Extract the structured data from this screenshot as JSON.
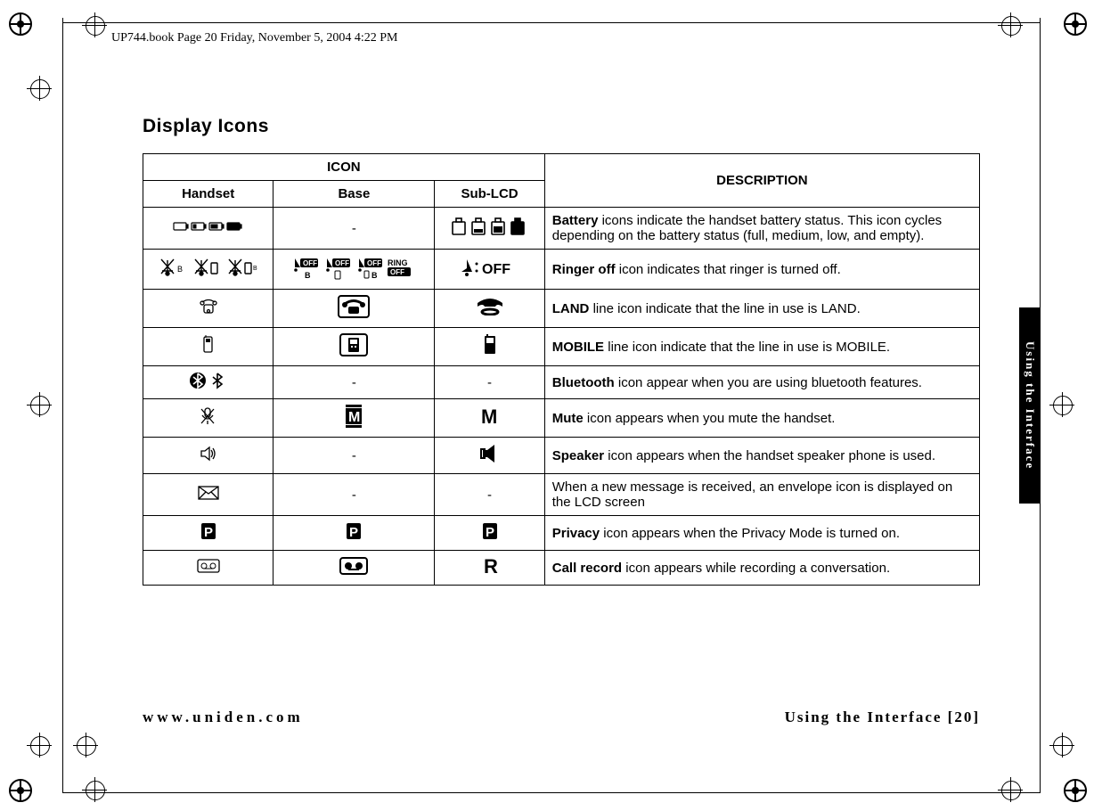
{
  "header_note": "UP744.book  Page 20  Friday, November 5, 2004  4:22 PM",
  "page_title": "Display Icons",
  "columns": {
    "icon": "ICON",
    "handset": "Handset",
    "base": "Base",
    "sublcd": "Sub-LCD",
    "description": "DESCRIPTION"
  },
  "rows": [
    {
      "lead": "Battery",
      "rest": " icons indicate the handset battery status. This icon cycles depending on the battery status (full, medium, low, and empty).",
      "base": "-",
      "sub": null,
      "handset": null
    },
    {
      "lead": "Ringer off",
      "rest": " icon indicates that ringer is turned off.",
      "base": null,
      "sub": null,
      "handset": null
    },
    {
      "lead": "LAND",
      "rest": " line icon indicate that the line in use is LAND.",
      "base": null,
      "sub": null,
      "handset": null
    },
    {
      "lead": "MOBILE",
      "rest": " line icon indicate that the line in use is MOBILE.",
      "base": null,
      "sub": null,
      "handset": null
    },
    {
      "lead": "Bluetooth",
      "rest": " icon appear when you are using bluetooth features.",
      "base": "-",
      "sub": "-",
      "handset": null
    },
    {
      "lead": "Mute",
      "rest": " icon appears when you mute the handset.",
      "base": null,
      "sub": null,
      "handset": null
    },
    {
      "lead": "Speaker",
      "rest": " icon appears when the handset speaker phone is used.",
      "base": "-",
      "sub": null,
      "handset": null
    },
    {
      "lead": "",
      "rest": "When a new message is received, an envelope icon is displayed on the LCD screen",
      "base": "-",
      "sub": "-",
      "handset": null
    },
    {
      "lead": "Privacy",
      "rest": " icon appears when the Privacy Mode is turned on.",
      "base": null,
      "sub": null,
      "handset": null
    },
    {
      "lead": "Call record",
      "rest": " icon appears while recording a conversation.",
      "base": null,
      "sub": null,
      "handset": null
    }
  ],
  "side_tab": "Using the Interface",
  "footer_left": "www.uniden.com",
  "footer_right": "Using the Interface [20]"
}
